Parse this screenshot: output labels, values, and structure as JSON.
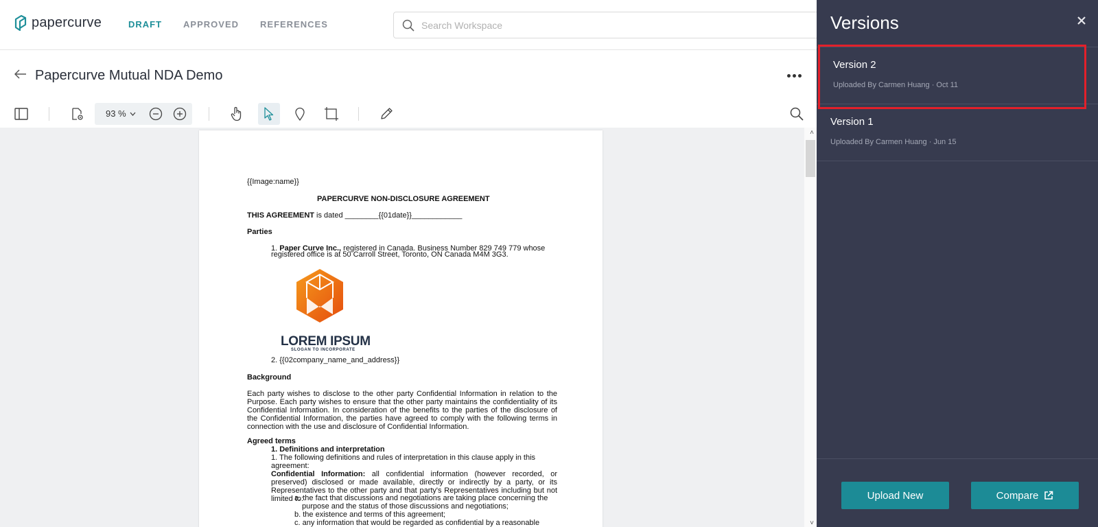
{
  "brand": {
    "name": "papercurve",
    "accent": "#1e8f99"
  },
  "nav": {
    "tabs": [
      {
        "label": "DRAFT",
        "active": true
      },
      {
        "label": "APPROVED",
        "active": false
      },
      {
        "label": "REFERENCES",
        "active": false
      }
    ]
  },
  "search": {
    "placeholder": "Search Workspace"
  },
  "document": {
    "title": "Papercurve Mutual NDA Demo"
  },
  "toolbar": {
    "zoom": "93 %"
  },
  "page": {
    "image_tag": "{{Image:name}}",
    "heading": "PAPERCURVE NON-DISCLOSURE AGREEMENT",
    "agreement_bold": "THIS AGREEMENT",
    "agreement_rest": " is dated ________{{01date}}____________",
    "parties": "Parties",
    "party1_num": "1. ",
    "party1_bold": "Paper Curve Inc.,",
    "party1_rest": " registered in Canada. Business Number 829 749 779 whose",
    "party1_line2": "registered office is at 50 Carroll Street, Toronto, ON Canada M4M 3G3.",
    "logo_text": "LOREM IPSUM",
    "logo_slogan": "SLOGAN TO INCORPORATE",
    "party2": "2. {{02company_name_and_address}}",
    "background": "Background",
    "background_text": "Each party wishes to disclose to the other party Confidential Information in relation to the Purpose. Each party wishes to ensure that the other party maintains the confidentiality of its Confidential Information. In consideration of the benefits to the parties of the disclosure of the Confidential Information, the parties have agreed to comply with the following terms in connection with the use and disclosure of Confidential Information.",
    "agreed_terms": "Agreed terms",
    "def_heading": "1. Definitions and interpretation",
    "def_1": "1. The following definitions and rules of interpretation in this clause apply in this",
    "def_1b": "agreement:",
    "ci_bold": "Confidential Information:",
    "ci_text": " all confidential information (however recorded, or preserved) disclosed or made available, directly or indirectly by a party, or its Representatives to the other party and that party's Representatives including but not limited to:",
    "item_a1": "a. the fact that discussions and negotiations are taking place concerning the",
    "item_a2": "purpose and the status of those discussions and negotiations;",
    "item_b": "b. the existence and terms of this agreement;",
    "item_c": "c. any information that would be regarded as confidential by a reasonable"
  },
  "panel": {
    "title": "Versions",
    "versions": [
      {
        "name": "Version 2",
        "meta": "Uploaded By Carmen Huang · Oct 11"
      },
      {
        "name": "Version 1",
        "meta": "Uploaded By Carmen Huang · Jun 15"
      }
    ],
    "upload_label": "Upload New",
    "compare_label": "Compare",
    "highlight_color": "#e3202a"
  },
  "icons": [
    "logo-icon",
    "search-icon",
    "back-arrow-icon",
    "more-icon",
    "sidebar-toggle-icon",
    "page-settings-icon",
    "chevron-down-icon",
    "zoom-out-icon",
    "zoom-in-icon",
    "hand-tool-icon",
    "pointer-tool-icon",
    "pin-icon",
    "crop-icon",
    "pencil-icon",
    "search-doc-icon",
    "close-icon",
    "external-link-icon"
  ]
}
